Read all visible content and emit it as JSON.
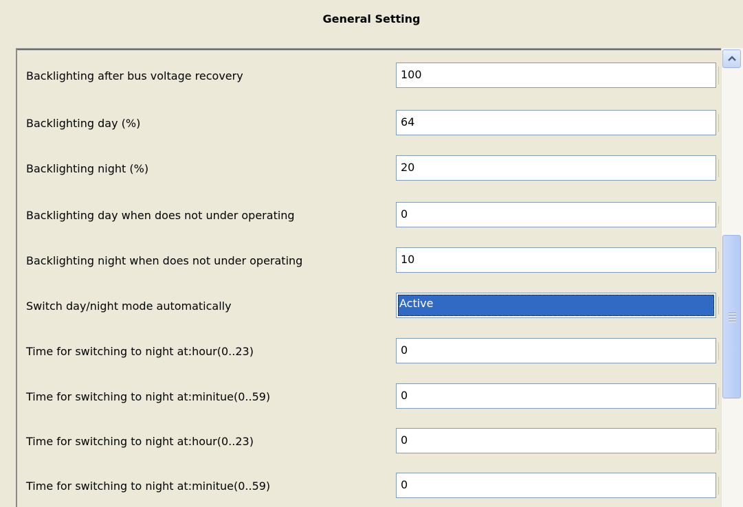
{
  "header": {
    "title": "General Setting"
  },
  "settings": [
    {
      "label": "Backlighting after bus voltage recovery",
      "value": "100"
    },
    {
      "label": "Backlighting day (%)",
      "value": "64"
    },
    {
      "label": "Backlighting night (%)",
      "value": "20"
    },
    {
      "label": "Backlighting day when does not under operating",
      "value": "0"
    },
    {
      "label": "Backlighting night when does not under operating",
      "value": "10"
    },
    {
      "label": "Switch day/night mode automatically",
      "value": "Active"
    },
    {
      "label": "Time for switching to night at:hour(0..23)",
      "value": "0"
    },
    {
      "label": "Time for switching to night at:minitue(0..59)",
      "value": "0"
    },
    {
      "label": "Time for switching to night at:hour(0..23)",
      "value": "0"
    },
    {
      "label": "Time for switching to night at:minitue(0..59)",
      "value": "0"
    }
  ],
  "colors": {
    "background": "#ECE9D8",
    "selection": "#316AC5",
    "field_border": "#7F9DB9"
  }
}
